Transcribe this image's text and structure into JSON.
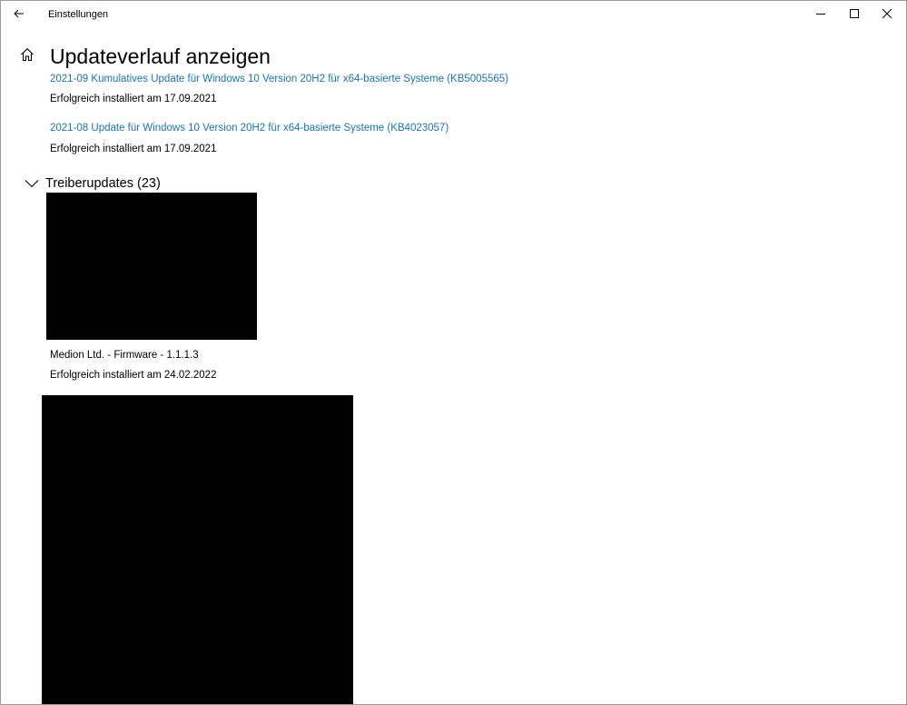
{
  "window": {
    "title": "Einstellungen"
  },
  "page": {
    "title": "Updateverlauf anzeigen"
  },
  "quality_updates": [
    {
      "name": "2021-09 Kumulatives Update für Windows 10 Version 20H2 für x64-basierte Systeme (KB5005565)",
      "status": "Erfolgreich installiert am 17.09.2021"
    },
    {
      "name": "2021-08 Update für Windows 10 Version 20H2 für x64-basierte Systeme (KB4023057)",
      "status": "Erfolgreich installiert am 17.09.2021"
    }
  ],
  "driver_group": {
    "title": "Treiberupdates (23)",
    "items": [
      {
        "name": "Medion Ltd. - Firmware - 1.1.1.3",
        "status": "Erfolgreich installiert am 24.02.2022"
      }
    ]
  },
  "icons": {
    "back": "back-arrow-icon",
    "home": "home-icon",
    "chevron": "chevron-down-icon",
    "minimize": "minimize-icon",
    "maximize": "maximize-icon",
    "close": "close-icon"
  },
  "colors": {
    "link": "#1a74b8",
    "redaction": "#000000",
    "background": "#ffffff"
  }
}
